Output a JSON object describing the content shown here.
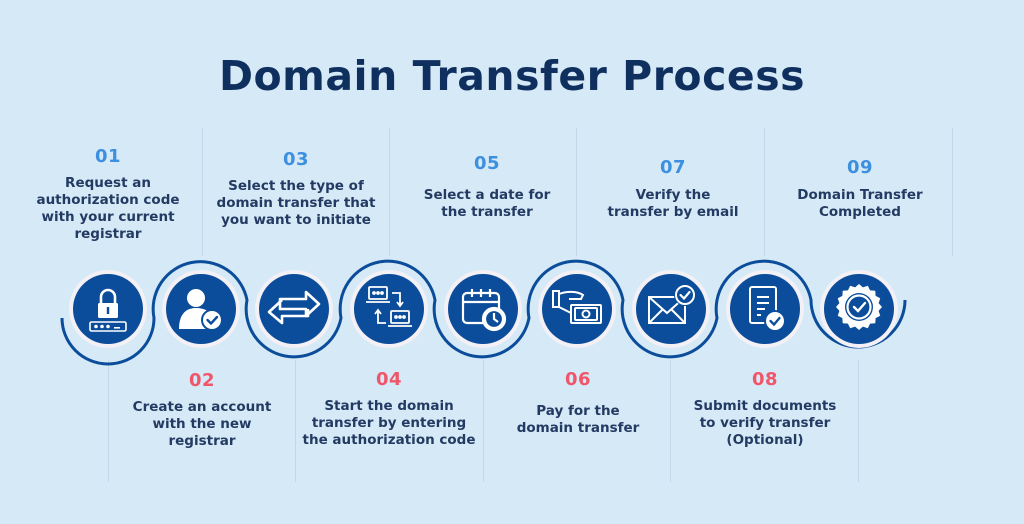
{
  "title": "Domain Transfer Process",
  "colors": {
    "background": "#d6e9f6",
    "title": "#0f2f5e",
    "circle_fill": "#0b4d9a",
    "circle_ring": "#f3f0f6",
    "wave": "#0b4d9a",
    "number_top": "#3d8fe0",
    "number_bottom": "#f0566a",
    "label": "#233b63"
  },
  "steps": [
    {
      "number": "01",
      "label_lines": [
        "Request an",
        "authorization code",
        "with your current",
        "registrar"
      ],
      "position": "top",
      "icon": "lock-password-icon"
    },
    {
      "number": "02",
      "label_lines": [
        "Create an account",
        "with the new",
        "registrar"
      ],
      "position": "bottom",
      "icon": "user-check-icon"
    },
    {
      "number": "03",
      "label_lines": [
        "Select the type of",
        "domain transfer that",
        "you want to initiate"
      ],
      "position": "top",
      "icon": "transfer-arrows-icon"
    },
    {
      "number": "04",
      "label_lines": [
        "Start the domain",
        "transfer by entering",
        "the authorization code"
      ],
      "position": "bottom",
      "icon": "laptops-exchange-icon"
    },
    {
      "number": "05",
      "label_lines": [
        "Select a date for",
        "the transfer"
      ],
      "position": "top",
      "icon": "calendar-clock-icon"
    },
    {
      "number": "06",
      "label_lines": [
        "Pay for the",
        "domain transfer"
      ],
      "position": "bottom",
      "icon": "hand-money-icon"
    },
    {
      "number": "07",
      "label_lines": [
        "Verify the",
        "transfer by email"
      ],
      "position": "top",
      "icon": "email-check-icon"
    },
    {
      "number": "08",
      "label_lines": [
        "Submit documents",
        "to verify transfer",
        "(Optional)"
      ],
      "position": "bottom",
      "icon": "document-check-icon"
    },
    {
      "number": "09",
      "label_lines": [
        "Domain Transfer",
        "Completed"
      ],
      "position": "top",
      "icon": "badge-check-icon"
    }
  ]
}
